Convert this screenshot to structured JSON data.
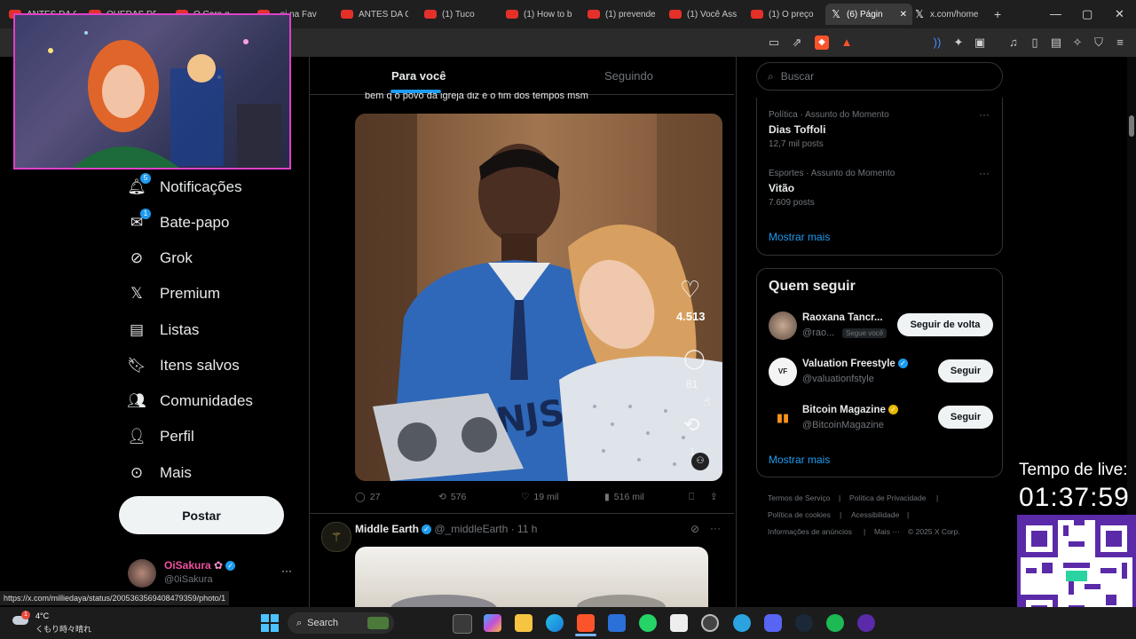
{
  "browser": {
    "tabs": [
      {
        "label": "ANTES DA C",
        "active": false
      },
      {
        "label": "QUEDAS DE",
        "active": false
      },
      {
        "label": "O Cara q",
        "active": false
      },
      {
        "label": "..ei na Fav",
        "active": false
      },
      {
        "label": "ANTES DA C",
        "active": false
      },
      {
        "label": "(1) Tuco",
        "active": false
      },
      {
        "label": "(1) How to b",
        "active": false
      },
      {
        "label": "(1) prevende",
        "active": false
      },
      {
        "label": "(1) Você Ass",
        "active": false
      },
      {
        "label": "(1) O preço",
        "active": false
      },
      {
        "label": "(6) Págin",
        "active": true
      },
      {
        "label": "x.com/home",
        "active": false
      }
    ],
    "new_tab": "+",
    "status_url": "https://x.com/milliedaya/status/2005363569408479359/photo/1"
  },
  "nav": {
    "items": [
      {
        "label": "Notificações",
        "icon": "bell-icon",
        "badge": "5"
      },
      {
        "label": "Bate-papo",
        "icon": "mail-icon",
        "badge": "1"
      },
      {
        "label": "Grok",
        "icon": "grok-icon"
      },
      {
        "label": "Premium",
        "icon": "x-logo-icon"
      },
      {
        "label": "Listas",
        "icon": "list-icon"
      },
      {
        "label": "Itens salvos",
        "icon": "bookmark-icon"
      },
      {
        "label": "Comunidades",
        "icon": "communities-icon"
      },
      {
        "label": "Perfil",
        "icon": "person-icon"
      },
      {
        "label": "Mais",
        "icon": "more-circle-icon"
      }
    ],
    "post_button": "Postar",
    "account": {
      "name": "OiSakura",
      "handle": "@0iSakura",
      "more": "···"
    }
  },
  "feed": {
    "tabs": [
      "Para você",
      "Seguindo"
    ],
    "tweet": {
      "text": "bem q o povo da igreja diz é o fim dos tempos msm",
      "overlay": {
        "likes": "4.513",
        "replies": "81",
        "more": "1"
      },
      "actions": {
        "replies": "27",
        "reposts": "576",
        "likes": "19 mil",
        "views": "516 mil"
      }
    },
    "next_tweet": {
      "name": "Middle Earth",
      "handle": "@_middleEarth",
      "time": "· 11 h",
      "more": "···"
    }
  },
  "sidebar": {
    "search_placeholder": "Buscar",
    "trends": [
      {
        "category": "Política · Assunto do Momento",
        "name": "Dias Toffoli",
        "posts": "12,7 mil posts"
      },
      {
        "category": "Esportes · Assunto do Momento",
        "name": "Vitão",
        "posts": "7.609 posts"
      }
    ],
    "trends_more": "Mostrar mais",
    "who_to_follow": {
      "title": "Quem seguir",
      "accounts": [
        {
          "name": "Raoxana Tancr...",
          "handle": "@rao...",
          "tag": "Segue você",
          "button": "Seguir de volta"
        },
        {
          "name": "Valuation Freestyle",
          "handle": "@valuationfstyle",
          "button": "Seguir"
        },
        {
          "name": "Bitcoin Magazine",
          "handle": "@BitcoinMagazine",
          "button": "Seguir"
        }
      ],
      "more": "Mostrar mais"
    },
    "footer": [
      "Termos de Serviço",
      "|",
      "Política de Privacidade",
      "|",
      "Política de cookies",
      "|",
      "Acessibilidade",
      "|",
      "Informações de anúncios",
      "|",
      "Mais ···",
      "© 2025 X Corp."
    ]
  },
  "stream": {
    "live_label": "Tempo de live:",
    "live_time": "01:37:59"
  },
  "taskbar": {
    "weather_temp": "4°C",
    "weather_desc": "くもり時々晴れ",
    "search": "Search"
  },
  "colors": {
    "accent": "#1d9bf0",
    "background": "#000000",
    "border": "#2f3336"
  }
}
